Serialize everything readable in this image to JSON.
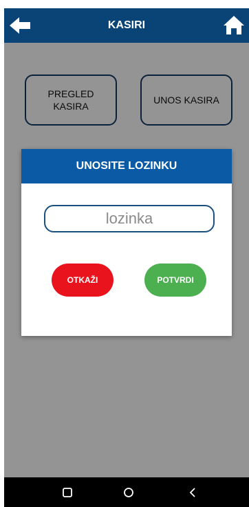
{
  "header": {
    "title": "KASIRI",
    "back_icon": "arrow-left-icon",
    "home_icon": "home-icon"
  },
  "tiles": [
    {
      "line1": "PREGLED",
      "line2": "KASIRA"
    },
    {
      "label": "UNOS KASIRA"
    }
  ],
  "dialog": {
    "title": "UNOSITE LOZINKU",
    "password_placeholder": "lozinka",
    "password_value": "",
    "cancel_label": "OTKAŽI",
    "confirm_label": "POTVRDI"
  },
  "colors": {
    "appbar": "#0a4477",
    "dialog_header": "#0a5aa6",
    "cancel": "#e8131c",
    "confirm": "#4caf50"
  },
  "navbar": {
    "icons": [
      "recent-apps-icon",
      "home-circle-icon",
      "back-chevron-icon"
    ]
  }
}
